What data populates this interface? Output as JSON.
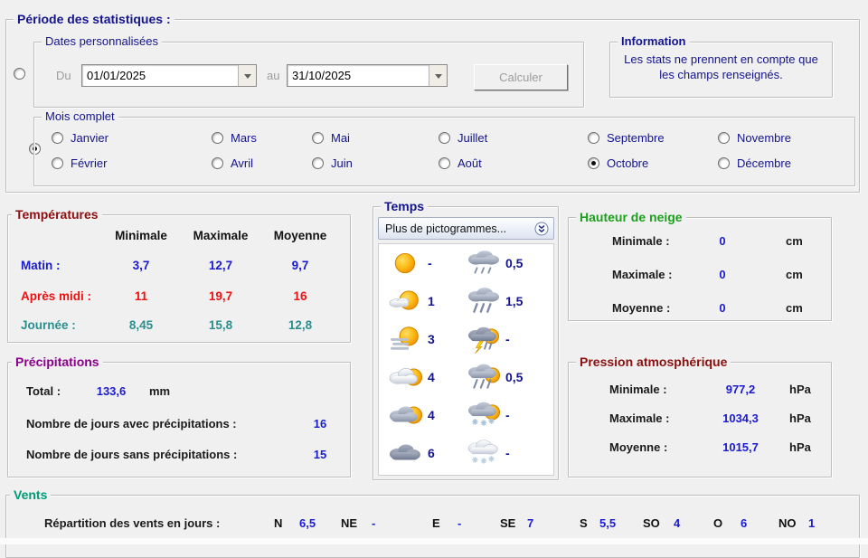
{
  "periode": {
    "title": "Période des statistiques :",
    "mode": "mois-complet",
    "custom": {
      "title": "Dates personnalisées",
      "du_label": "Du",
      "du_value": "01/01/2025",
      "au_label": "au",
      "au_value": "31/10/2025",
      "calculer_label": "Calculer"
    },
    "information": {
      "title": "Information",
      "text": "Les stats ne prennent en compte que les champs renseignés."
    },
    "mois": {
      "title": "Mois complet",
      "selected": "Octobre",
      "months": [
        "Janvier",
        "Février",
        "Mars",
        "Avril",
        "Mai",
        "Juin",
        "Juillet",
        "Août",
        "Septembre",
        "Octobre",
        "Novembre",
        "Décembre"
      ]
    }
  },
  "temperatures": {
    "title": "Températures",
    "headers": [
      "Minimale",
      "Maximale",
      "Moyenne"
    ],
    "rows": [
      {
        "label": "Matin :",
        "values": [
          "3,7",
          "12,7",
          "9,7"
        ]
      },
      {
        "label": "Après midi :",
        "values": [
          "11",
          "19,7",
          "16"
        ]
      },
      {
        "label": "Journée :",
        "values": [
          "8,45",
          "15,8",
          "12,8"
        ]
      }
    ]
  },
  "temps": {
    "title": "Temps",
    "more_label": "Plus de pictogrammes...",
    "items": [
      {
        "icon": "sun",
        "value": "-"
      },
      {
        "icon": "light-rain",
        "value": "0,5"
      },
      {
        "icon": "sun-with-small-cloud",
        "value": "1"
      },
      {
        "icon": "heavy-rain",
        "value": "1,5"
      },
      {
        "icon": "sun-haze",
        "value": "3"
      },
      {
        "icon": "thunderstorm-sun",
        "value": "-"
      },
      {
        "icon": "light-cloud-sun",
        "value": "4"
      },
      {
        "icon": "rain-with-sun",
        "value": "0,5"
      },
      {
        "icon": "cloud-with-sun",
        "value": "4"
      },
      {
        "icon": "snow-with-sun",
        "value": "-"
      },
      {
        "icon": "cloud",
        "value": "6"
      },
      {
        "icon": "snow",
        "value": "-"
      }
    ]
  },
  "neige": {
    "title": "Hauteur de neige",
    "rows": [
      {
        "label": "Minimale :",
        "value": "0",
        "unit": "cm"
      },
      {
        "label": "Maximale :",
        "value": "0",
        "unit": "cm"
      },
      {
        "label": "Moyenne :",
        "value": "0",
        "unit": "cm"
      }
    ]
  },
  "precipitations": {
    "title": "Précipitations",
    "total_label": "Total :",
    "total_value": "133,6",
    "total_unit": "mm",
    "avec_label": "Nombre de jours avec précipitations :",
    "avec_value": "16",
    "sans_label": "Nombre de jours sans précipitations :",
    "sans_value": "15"
  },
  "pression": {
    "title": "Pression atmosphérique",
    "rows": [
      {
        "label": "Minimale :",
        "value": "977,2",
        "unit": "hPa"
      },
      {
        "label": "Maximale :",
        "value": "1034,3",
        "unit": "hPa"
      },
      {
        "label": "Moyenne :",
        "value": "1015,7",
        "unit": "hPa"
      }
    ]
  },
  "vents": {
    "title": "Vents",
    "repartition_label": "Répartition des vents en jours :",
    "directions": [
      {
        "dir": "N",
        "value": "6,5"
      },
      {
        "dir": "NE",
        "value": "-"
      },
      {
        "dir": "E",
        "value": "-"
      },
      {
        "dir": "SE",
        "value": "7"
      },
      {
        "dir": "S",
        "value": "5,5"
      },
      {
        "dir": "SO",
        "value": "4"
      },
      {
        "dir": "O",
        "value": "6"
      },
      {
        "dir": "NO",
        "value": "1"
      }
    ]
  }
}
